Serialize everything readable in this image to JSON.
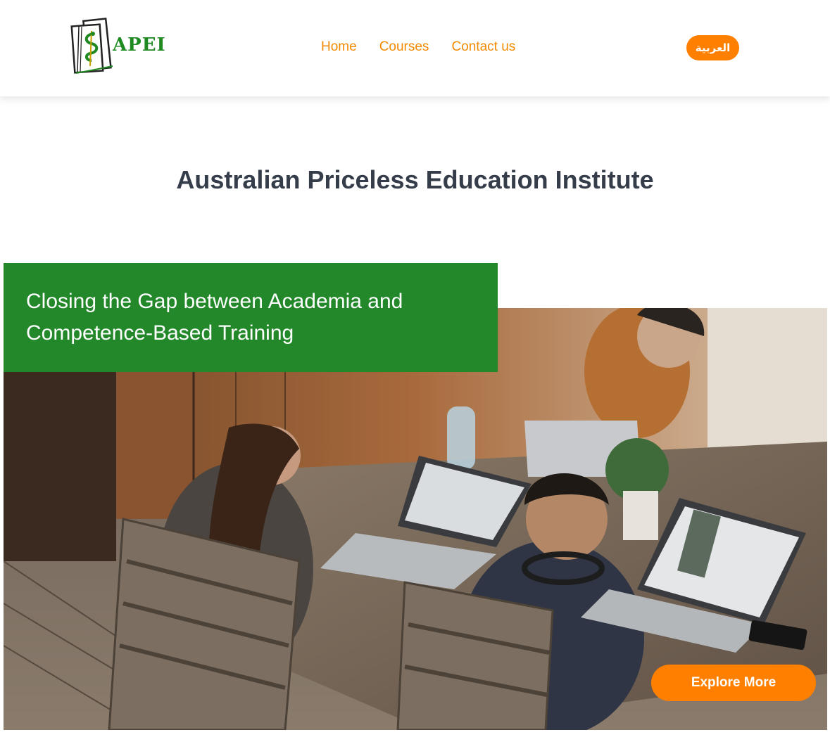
{
  "header": {
    "logo_text": "APEI",
    "nav": [
      {
        "label": "Home"
      },
      {
        "label": "Courses"
      },
      {
        "label": "Contact us"
      }
    ],
    "language_button": "العربية"
  },
  "main": {
    "title": "Australian Priceless Education Institute",
    "hero": {
      "tagline": "Closing the Gap between Academia and Competence-Based Training",
      "cta_label": "Explore More"
    }
  },
  "colors": {
    "brand_green": "#22882a",
    "accent_orange": "#ff7f00",
    "nav_orange": "#f28a00",
    "title_dark": "#353d4b"
  },
  "icons": {
    "logo": "book-caduceus-icon"
  }
}
